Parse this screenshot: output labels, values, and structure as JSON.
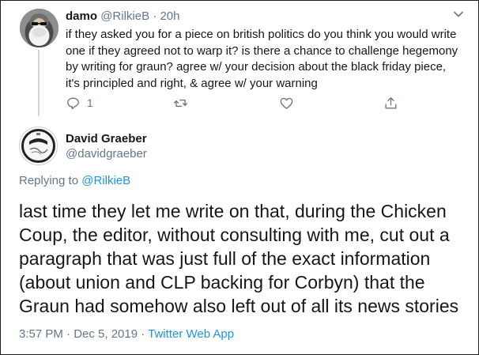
{
  "reply": {
    "name": "damo",
    "handle": "@RilkieB",
    "separator": "·",
    "time": "20h",
    "text": "if they asked you for a piece on british politics do you think you would write one if they agreed not to warp it? is there a chance to challenge hegemony by writing for graun? agree w/ your decision about the black friday piece, it's principled and right, & agree w/ your warning",
    "reply_count": "1",
    "icons": [
      "reply-icon",
      "retweet-icon",
      "like-icon",
      "share-icon",
      "chevron-down-icon"
    ]
  },
  "tweet": {
    "name": "David Graeber",
    "handle": "@davidgraeber",
    "replying_prefix": "Replying to",
    "replying_to": "@RilkieB",
    "text": "last time they let me write on that, during the Chicken Coup, the editor, without consulting with me, cut out a paragraph that was just full of the exact information (about union and CLP backing for Corbyn) that the Graun had somehow also left out of all its news stories",
    "timestamp": "3:57 PM · Dec 5, 2019 · ",
    "app": "Twitter Web App"
  },
  "colors": {
    "text": "#14171a",
    "secondary": "#657786",
    "link": "#1b95e0",
    "thread_line": "#ccd6dd"
  }
}
